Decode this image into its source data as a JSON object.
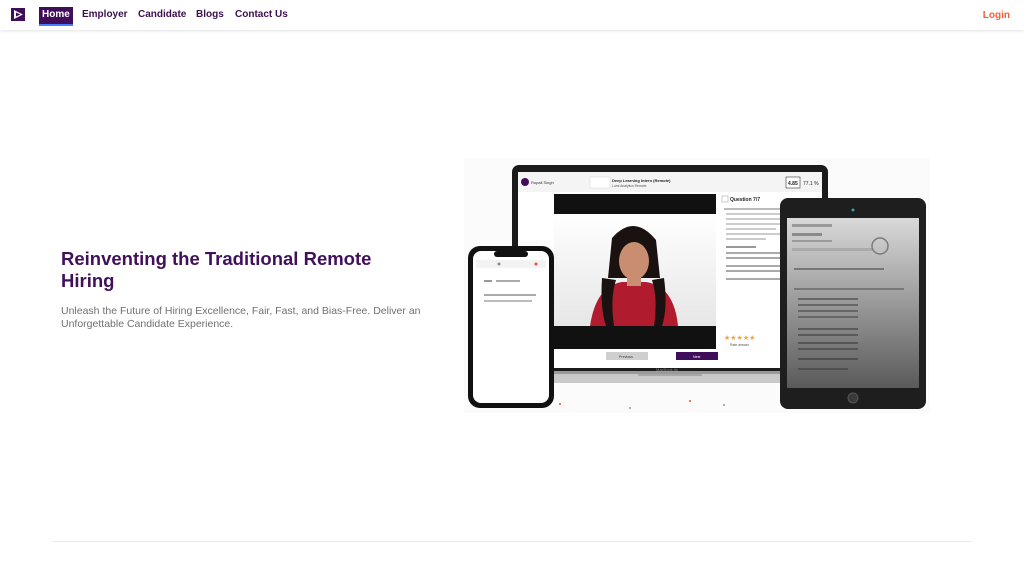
{
  "nav": {
    "items": [
      {
        "label": "Home",
        "active": true
      },
      {
        "label": "Employer",
        "active": false
      },
      {
        "label": "Candidate",
        "active": false
      },
      {
        "label": "Blogs",
        "active": false
      },
      {
        "label": "Contact Us",
        "active": false
      }
    ],
    "login_label": "Login"
  },
  "hero": {
    "title": "Reinventing the Traditional Remote Hiring",
    "subtitle": "Unleash the Future of Hiring Excellence, Fair, Fast, and Bias-Free. Deliver an Unforgettable Candidate Experience."
  },
  "mockup": {
    "laptop": {
      "user_name": "Rupali Singh",
      "job_title": "Deep Learning Intern (Remote)",
      "company": "Lumi Analytics Remote",
      "score": "4.85",
      "percent": "77.1 %",
      "question_label": "Question 7/7",
      "prev_label": "Previous",
      "next_label": "Next",
      "rate_label": "Rate answer",
      "brand_label": "MacBook Air"
    }
  },
  "colors": {
    "brand": "#3f0d59",
    "accent": "#f2603a",
    "muted_text": "#707070"
  }
}
